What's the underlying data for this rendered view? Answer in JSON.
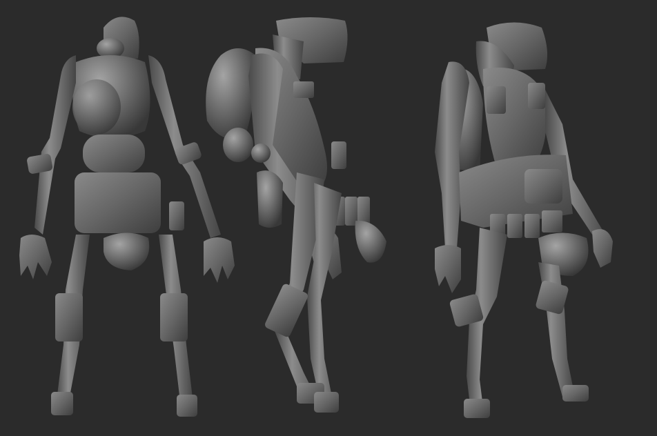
{
  "scene": {
    "background_color": "#2b2b2b",
    "material_color": "#6a6a6a",
    "views": [
      {
        "id": "back",
        "name": "back-view"
      },
      {
        "id": "side",
        "name": "side-view"
      },
      {
        "id": "three-quarter",
        "name": "three-quarter-view"
      }
    ]
  }
}
